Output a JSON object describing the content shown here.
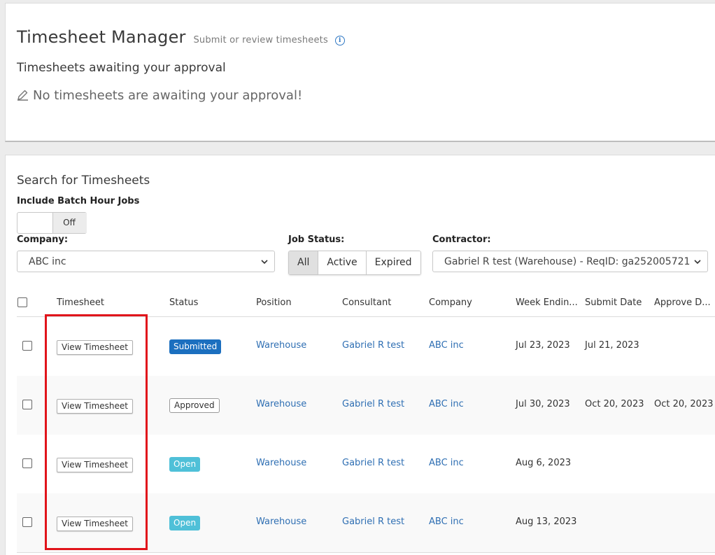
{
  "header": {
    "title": "Timesheet Manager",
    "subtitle": "Submit or review timesheets",
    "approval_heading": "Timesheets awaiting your approval",
    "empty_message": "No timesheets are awaiting your approval!"
  },
  "search": {
    "title": "Search for Timesheets",
    "batch_label": "Include Batch Hour Jobs",
    "batch_toggle": "Off",
    "company_label": "Company:",
    "company_value": "ABC inc",
    "job_status_label": "Job Status:",
    "job_status_options": [
      "All",
      "Active",
      "Expired"
    ],
    "job_status_selected": "All",
    "contractor_label": "Contractor:",
    "contractor_value": "Gabriel R test (Warehouse) - ReqID: ga252005721"
  },
  "table": {
    "columns": [
      "Timesheet",
      "Status",
      "Position",
      "Consultant",
      "Company",
      "Week Endin...",
      "Submit Date",
      "Approve D..."
    ],
    "rows": [
      {
        "action": "View Timesheet",
        "status": "Submitted",
        "position": "Warehouse",
        "consultant": "Gabriel R test",
        "company": "ABC inc",
        "week_ending": "Jul 23, 2023",
        "submit_date": "Jul 21, 2023",
        "approve_date": ""
      },
      {
        "action": "View Timesheet",
        "status": "Approved",
        "position": "Warehouse",
        "consultant": "Gabriel R test",
        "company": "ABC inc",
        "week_ending": "Jul 30, 2023",
        "submit_date": "Oct 20, 2023",
        "approve_date": "Oct 20, 2023"
      },
      {
        "action": "View Timesheet",
        "status": "Open",
        "position": "Warehouse",
        "consultant": "Gabriel R test",
        "company": "ABC inc",
        "week_ending": "Aug 6, 2023",
        "submit_date": "",
        "approve_date": ""
      },
      {
        "action": "View Timesheet",
        "status": "Open",
        "position": "Warehouse",
        "consultant": "Gabriel R test",
        "company": "ABC inc",
        "week_ending": "Aug 13, 2023",
        "submit_date": "",
        "approve_date": ""
      }
    ]
  },
  "colors": {
    "submitted": "#1b6fbf",
    "open": "#4fc0d8",
    "link": "#2f6fb3",
    "highlight": "#e1141b"
  },
  "icons": [
    "info-icon",
    "pencil-icon",
    "chevron-down-icon"
  ]
}
